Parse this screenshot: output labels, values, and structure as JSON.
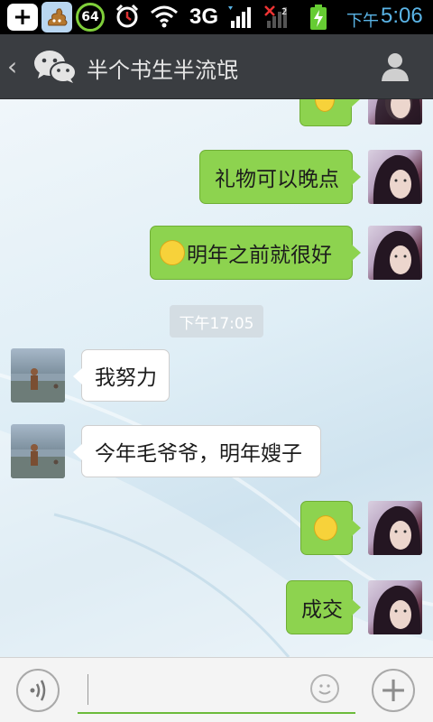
{
  "status_bar": {
    "plus_icon": "plus-icon",
    "notification_count": "64",
    "network_type": "3G",
    "signal_suffix": "2",
    "time_prefix": "下午",
    "time": "5:06"
  },
  "header": {
    "back_icon": "back-chevron-icon",
    "app_icon": "wechat-icon",
    "title": "半个书生半流氓",
    "contact_icon": "contact-profile-icon"
  },
  "messages": [
    {
      "sender": "me",
      "type": "emoji",
      "emoji": "wink-emoji"
    },
    {
      "sender": "me",
      "type": "text",
      "text": "礼物可以晚点"
    },
    {
      "sender": "me",
      "type": "text",
      "emoji": "grin-emoji",
      "text": "明年之前就很好"
    },
    {
      "sender": "system",
      "type": "timestamp",
      "text": "下午17:05"
    },
    {
      "sender": "other",
      "type": "text",
      "text": "我努力"
    },
    {
      "sender": "other",
      "type": "text",
      "text": "今年毛爷爷，明年嫂子"
    },
    {
      "sender": "me",
      "type": "emoji",
      "emoji": "tongue-grin-emoji"
    },
    {
      "sender": "me",
      "type": "text",
      "text": "成交"
    }
  ],
  "input_bar": {
    "voice_icon": "voice-icon",
    "input_value": "",
    "smiley_icon": "smiley-icon",
    "add_icon": "plus-circle-icon"
  },
  "colors": {
    "my_bubble": "#8dd34f",
    "other_bubble": "#ffffff",
    "header_bg": "#3a3d41",
    "accent_time": "#5ab4e6"
  }
}
